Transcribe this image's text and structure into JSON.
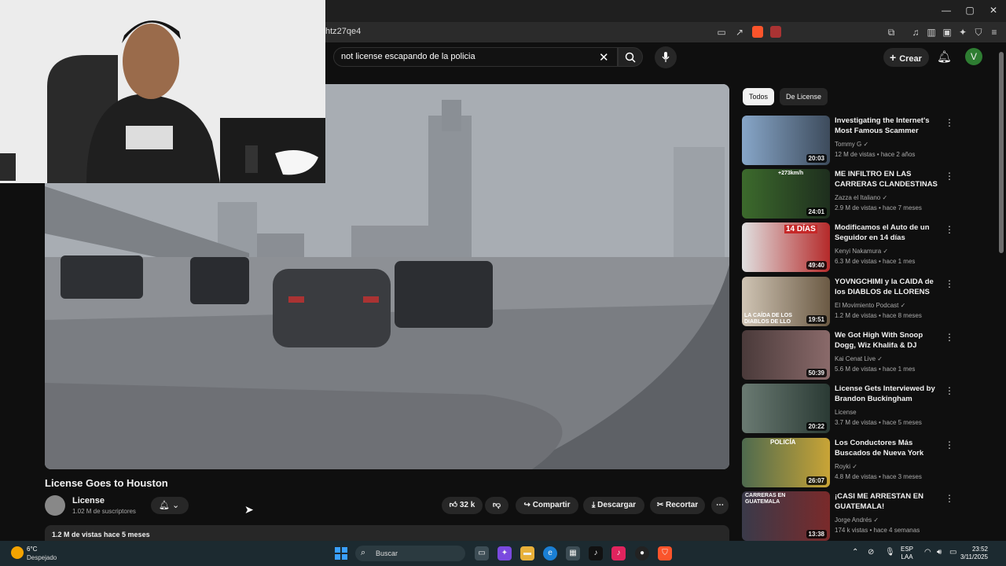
{
  "browser": {
    "url_fragment": "htz27qe4",
    "window_controls": [
      "—",
      "▢",
      "✕"
    ]
  },
  "header": {
    "search_value": "not license escapando de la policia",
    "create_label": "Crear",
    "avatar_letter": "V"
  },
  "video": {
    "title": "License Goes to Houston",
    "channel": "License",
    "subscribers": "1.02 M de suscriptores",
    "likes": "32 k",
    "share_label": "Compartir",
    "download_label": "Descargar",
    "clip_label": "Recortar",
    "views_date": "1.2 M de vistas  hace 5 meses"
  },
  "chips": [
    "Todos",
    "De License"
  ],
  "recommendations": [
    {
      "title": "Investigating the Internet's Most Famous Scammer",
      "channel": "Tommy G",
      "meta": "12 M de vistas • hace 2 años",
      "duration": "20:03",
      "color": "#4a6a8a"
    },
    {
      "title": "ME INFILTRO EN LAS CARRERAS CLANDESTINAS D...",
      "channel": "Zazza el Italiano",
      "meta": "2.9 M de vistas • hace 7 meses",
      "duration": "24:01",
      "color": "#3a5a3a"
    },
    {
      "title": "Modificamos el Auto de un Seguidor en 14 días",
      "channel": "Kenyi Nakamura",
      "meta": "6.3 M de vistas • hace 1 mes",
      "duration": "49:40",
      "color": "#7a2a2a"
    },
    {
      "title": "YOVNGCHIMI y la CAIDA de los DIABLOS de LLORENS",
      "channel": "El Movimiento Podcast",
      "meta": "1.2 M de vistas • hace 8 meses",
      "duration": "19:51",
      "color": "#5a4a3a"
    },
    {
      "title": "We Got High With Snoop Dogg, Wiz Khalifa & DJ Ghost...",
      "channel": "Kai Cenat Live",
      "meta": "5.6 M de vistas • hace 1 mes",
      "duration": "50:39",
      "color": "#6a5a5a"
    },
    {
      "title": "License Gets Interviewed by Brandon Buckingham",
      "channel": "License",
      "meta": "3.7 M de vistas • hace 5 meses",
      "duration": "20:22",
      "color": "#2a4a4a"
    },
    {
      "title": "Los Conductores Más Buscados de Nueva York",
      "channel": "Royki",
      "meta": "4.8 M de vistas • hace 3 meses",
      "duration": "26:07",
      "color": "#8a6a2a"
    },
    {
      "title": "¡CASI ME ARRESTAN EN GUATEMALA!",
      "channel": "Jorge Andrés",
      "meta": "174 k vistas • hace 4 semanas",
      "duration": "13:38",
      "color": "#7a3a3a"
    }
  ],
  "thumb_labels": {
    "r2": "+273km/h",
    "r3": "14 DÍAS",
    "r4": "LA CAÍDA DE LOS DIABLOS DE LLO",
    "r7": "POLICÍA",
    "r8": "CARRERAS EN GUATEMALA"
  },
  "taskbar": {
    "temperature": "6°C",
    "weather": "Despejado",
    "search_label": "Buscar",
    "lang_top": "ESP",
    "lang_bottom": "LAA",
    "time": "23:52",
    "date": "3/11/2025"
  }
}
